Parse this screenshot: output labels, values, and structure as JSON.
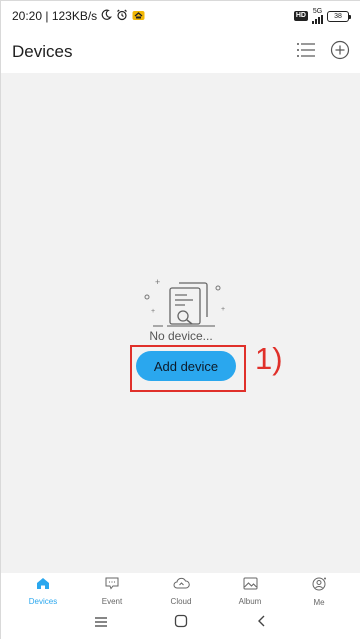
{
  "status_bar": {
    "time_speed": "20:20 | 123KB/s",
    "network_type": "5G",
    "hd_label": "HD",
    "battery": "38"
  },
  "header": {
    "title": "Devices"
  },
  "main": {
    "empty_text": "No device...",
    "add_button_label": "Add device",
    "annotation_label": "1)"
  },
  "bottom_nav": {
    "items": [
      {
        "label": "Devices",
        "icon": "home-icon",
        "active": true
      },
      {
        "label": "Event",
        "icon": "message-icon",
        "active": false
      },
      {
        "label": "Cloud",
        "icon": "cloud-icon",
        "active": false
      },
      {
        "label": "Album",
        "icon": "image-icon",
        "active": false
      },
      {
        "label": "Me",
        "icon": "user-icon",
        "active": false
      }
    ]
  },
  "colors": {
    "accent": "#2aa7ee",
    "annotation": "#e0302a",
    "background": "#f2f2f2"
  }
}
